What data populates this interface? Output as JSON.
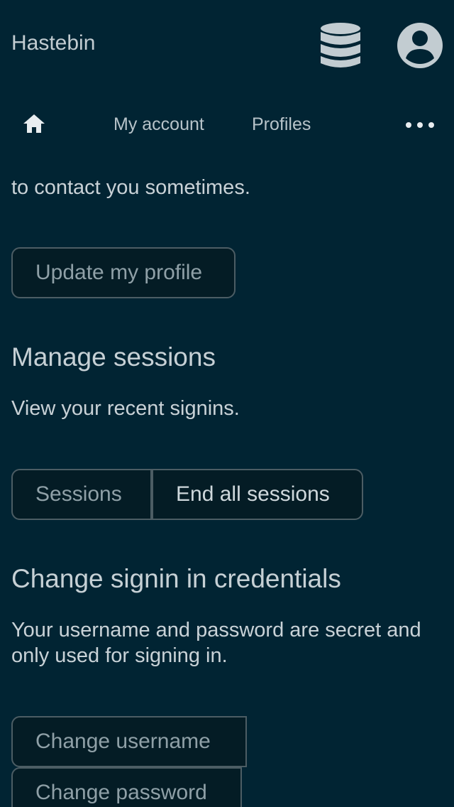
{
  "header": {
    "title": "Hastebin",
    "icons": [
      "database-icon",
      "account-circle-icon"
    ]
  },
  "nav": {
    "home_icon": "home-icon",
    "links": [
      "My account",
      "Profiles"
    ],
    "more_icon": "more-horizontal-icon"
  },
  "colors": {
    "background": "#012433",
    "button_background": "#041c25",
    "button_border": "#4c5d64",
    "text": "#c9d2d7"
  },
  "content": {
    "intro_tail": "to contact you sometimes.",
    "update_profile_button": "Update my profile",
    "sessions": {
      "heading": "Manage sessions",
      "description": "View your recent signins.",
      "sessions_button": "Sessions",
      "end_all_button": "End all sessions"
    },
    "credentials": {
      "heading": "Change signin in credentials",
      "description": "Your username and password are secret and only used for signing in.",
      "change_username_button": "Change username",
      "change_password_button": "Change password"
    }
  }
}
